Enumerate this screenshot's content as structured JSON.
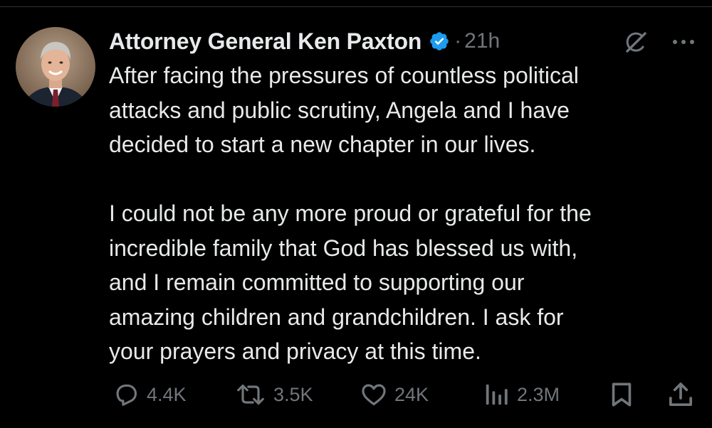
{
  "tweet": {
    "author": {
      "display_name": "Attorney General Ken Paxton",
      "verified": true,
      "avatar": "avatar"
    },
    "separator": "·",
    "time": "21h",
    "header_icons": [
      "grok-icon",
      "more-icon"
    ],
    "body_lines": [
      "After facing the pressures of countless political",
      "attacks and public scrutiny, Angela and I have",
      "decided to start a new chapter in our lives.",
      "",
      "I could not be any more proud or grateful for the",
      "incredible family that God has blessed us with,",
      "and I remain committed to supporting our",
      "amazing children and grandchildren. I ask for",
      "your prayers and privacy at this time."
    ]
  },
  "actions": {
    "reply": {
      "icon": "reply-icon",
      "count": "4.4K"
    },
    "repost": {
      "icon": "repost-icon",
      "count": "3.5K"
    },
    "like": {
      "icon": "heart-icon",
      "count": "24K"
    },
    "views": {
      "icon": "views-icon",
      "count": "2.3M"
    },
    "bookmark": {
      "icon": "bookmark-icon"
    },
    "share": {
      "icon": "share-icon"
    }
  },
  "colors": {
    "background": "#000000",
    "text": "#e7e9ea",
    "secondary": "#71767b",
    "verified": "#1d9bf0"
  }
}
